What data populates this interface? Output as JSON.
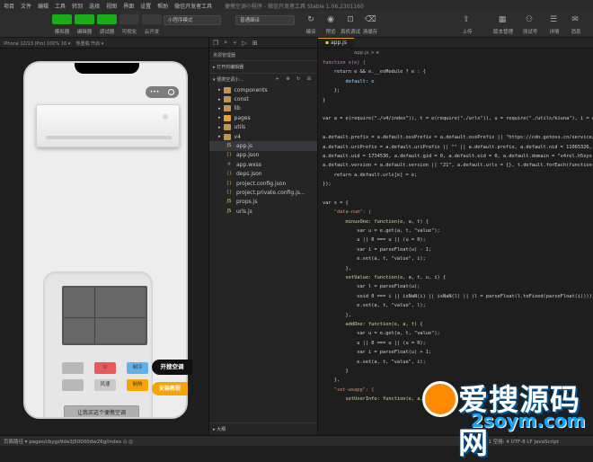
{
  "menubar": {
    "items": [
      "项目",
      "文件",
      "编辑",
      "工具",
      "转到",
      "选择",
      "视图",
      "界面",
      "设置",
      "帮助",
      "微信开发者工具"
    ],
    "title": "便携空调小程序 - 微信开发者工具 Stable 1.06.2301160"
  },
  "toolbar": {
    "left_buttons": [
      {
        "label": "模拟器",
        "color": "#1aad19"
      },
      {
        "label": "编辑器",
        "color": "#1aad19"
      },
      {
        "label": "调试器",
        "color": "#1aad19"
      },
      {
        "label": "可视化",
        "color": "#3a3a3a"
      },
      {
        "label": "云开发",
        "color": "#3a3a3a"
      }
    ],
    "mode_select": "小程序模式",
    "compile_select": "普通编译",
    "mid_labels": [
      "编译",
      "预览",
      "真机调试",
      "清缓存"
    ],
    "right_labels": [
      "上传",
      "版本管理",
      "测试号",
      "详情",
      "消息"
    ]
  },
  "sim": {
    "device": "iPhone 12/13 (Pro) 100% 16 ▾",
    "hot_reload": "热重载 开启 ▾",
    "capsule_dots": "•••",
    "remote": {
      "buttons": [
        {
          "label": "",
          "color": "#b8b8b8"
        },
        {
          "label": "⏻",
          "color": "#e85a5a"
        },
        {
          "label": "制冷",
          "color": "#5fb0ec"
        },
        {
          "label": "",
          "color": "#b8b8b8"
        },
        {
          "label": "风速",
          "color": "#c8c8c8"
        },
        {
          "label": "制热",
          "color": "#f6a400"
        }
      ],
      "big_button": "让我买这个便携空调"
    },
    "pill_primary": "开搜空调",
    "pill_secondary": "安装教程"
  },
  "explorer": {
    "title": "资源管理器",
    "section_open": "打开的编辑器",
    "section_project": "便携空调小...",
    "items": [
      {
        "label": "components",
        "type": "folder",
        "color": "#c09553"
      },
      {
        "label": "const",
        "type": "folder",
        "color": "#c09553"
      },
      {
        "label": "lib",
        "type": "folder",
        "color": "#c09553"
      },
      {
        "label": "pages",
        "type": "folder",
        "color": "#e8a13a"
      },
      {
        "label": "utils",
        "type": "folder",
        "color": "#c09553"
      },
      {
        "label": "v4",
        "type": "folder",
        "color": "#c09553"
      },
      {
        "label": "app.js",
        "type": "js",
        "color": "#e8d44d",
        "selected": true
      },
      {
        "label": "app.json",
        "type": "json",
        "color": "#c9a227"
      },
      {
        "label": "app.wxss",
        "type": "css",
        "color": "#3d8fd4"
      },
      {
        "label": "deps.json",
        "type": "json",
        "color": "#c9a227"
      },
      {
        "label": "project.config.json",
        "type": "json",
        "color": "#c9a227"
      },
      {
        "label": "project.private.config.js...",
        "type": "json",
        "color": "#c9a227"
      },
      {
        "label": "props.js",
        "type": "js",
        "color": "#e8d44d"
      },
      {
        "label": "urls.js",
        "type": "js",
        "color": "#e8d44d"
      }
    ],
    "outline_section": "大纲"
  },
  "editor": {
    "tab": "app.js",
    "breadcrumb": "app.js > e",
    "lines": [
      [
        [
          "function e(e) {",
          "kw"
        ]
      ],
      [
        [
          "    return e && e.__esModule ? e : {",
          "cm"
        ]
      ],
      [
        [
          "        default: e",
          "var"
        ]
      ],
      [
        [
          "    };",
          "cm"
        ]
      ],
      [
        [
          "}",
          "cm"
        ]
      ],
      [
        [
          "",
          ""
        ]
      ],
      [
        [
          "var a = e(require(\"./v4/index\")), t = e(require(\"./urls\")), u = require(\"./utils/kiuna\"), i = e(r",
          "cm"
        ]
      ],
      [
        [
          "",
          ""
        ]
      ],
      [
        [
          "a.default.prefix = a.default.ossPrefix = a.default.ossPrefix || \"https://cdn.getoss.cn/service/fi",
          "cm"
        ]
      ],
      [
        [
          "a.default.uriPrefix = a.default.uriPrefix || \"\" || a.default.prefix, a.default.nid = 11065326,",
          "cm"
        ]
      ],
      [
        [
          "a.default.uid = 1734536, a.default.gid = 0, a.default.eid = 0, a.default.domain = \"v4rel.h5sys.cn",
          "cm"
        ]
      ],
      [
        [
          "a.default.version = a.default.version || \"21\", a.default.urls = {}, t.default.forEach(function(e)",
          "cm"
        ]
      ],
      [
        [
          "    return a.default.urls[e] = e;",
          "cm"
        ]
      ],
      [
        [
          "});",
          "cm"
        ]
      ],
      [
        [
          "",
          ""
        ]
      ],
      [
        [
          "var s = {",
          "cm"
        ]
      ],
      [
        [
          "    \"data-num\": {",
          "str"
        ]
      ],
      [
        [
          "        minusOne: function(e, a, t) {",
          "fn"
        ]
      ],
      [
        [
          "            var u = e.get(a, t, \"value\");",
          "cm"
        ]
      ],
      [
        [
          "            u || 0 === u || (u = 0);",
          "cm"
        ]
      ],
      [
        [
          "            var i = parseFloat(u) - 1;",
          "cm"
        ]
      ],
      [
        [
          "            e.set(a, t, \"value\", i);",
          "cm"
        ]
      ],
      [
        [
          "        },",
          "cm"
        ]
      ],
      [
        [
          "        setValue: function(e, a, t, u, i) {",
          "fn"
        ]
      ],
      [
        [
          "            var l = parseFloat(u);",
          "cm"
        ]
      ],
      [
        [
          "            void 0 === i || isNaN(i) || isNaN(l) || (l = parseFloat(l.toFixed(parseFloat(i)))),",
          "cm"
        ]
      ],
      [
        [
          "            e.set(a, t, \"value\", l);",
          "cm"
        ]
      ],
      [
        [
          "        },",
          "cm"
        ]
      ],
      [
        [
          "        addOne: function(e, a, t) {",
          "fn"
        ]
      ],
      [
        [
          "            var u = e.get(a, t, \"value\");",
          "cm"
        ]
      ],
      [
        [
          "            u || 0 === u || (u = 0);",
          "cm"
        ]
      ],
      [
        [
          "            var i = parseFloat(u) + 1;",
          "cm"
        ]
      ],
      [
        [
          "            e.set(a, t, \"value\", i);",
          "cm"
        ]
      ],
      [
        [
          "        }",
          "cm"
        ]
      ],
      [
        [
          "    },",
          "cm"
        ]
      ],
      [
        [
          "    \"set-wxapp\": {",
          "str"
        ]
      ],
      [
        [
          "        setUserInfo: function(e, a, t, u, i) {",
          "fn"
        ]
      ]
    ]
  },
  "status": {
    "path": "页面路径 ▾    pages/cbygz9da3j50000dw26g/index  ⊙  ◎",
    "right": "行 1，列 1   空格: 4   UTF-8   LF   JavaScript"
  },
  "watermark": {
    "line1": "爱搜源码网",
    "line2": "2soym.com"
  }
}
